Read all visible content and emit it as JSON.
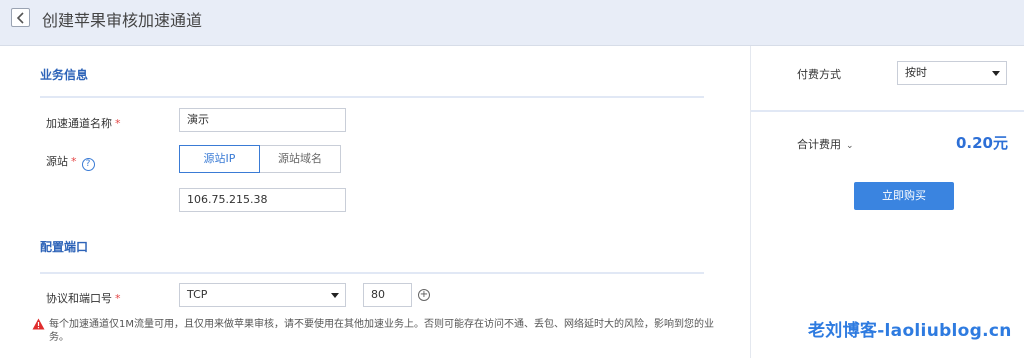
{
  "header": {
    "title": "创建苹果审核加速通道"
  },
  "business": {
    "title": "业务信息",
    "name_label": "加速通道名称",
    "name_value": "演示",
    "origin_label": "源站",
    "origin_tabs": [
      {
        "label": "源站IP",
        "active": true
      },
      {
        "label": "源站域名",
        "active": false
      }
    ],
    "origin_ip_value": "106.75.215.38"
  },
  "port": {
    "title": "配置端口",
    "label": "协议和端口号",
    "protocol_value": "TCP",
    "port_value": "80"
  },
  "notice": "每个加速通道仅1M流量可用，且仅用来做苹果审核，请不要使用在其他加速业务上。否则可能存在访问不通、丢包、网络延时大的风险，影响到您的业务。",
  "billing": {
    "method_label": "付费方式",
    "method_value": "按时",
    "total_label": "合计费用",
    "total_value": "0.20元",
    "buy_label": "立即购买"
  },
  "watermark": "老刘博客-laoliublog.cn",
  "colors": {
    "accent": "#3a7bd5",
    "required": "#e54545",
    "warning": "#e02d2d"
  },
  "icons": {
    "back": "chevron-left",
    "help": "question-circle",
    "add": "plus-circle",
    "warning": "warning-triangle",
    "expand": "chevron-down"
  }
}
